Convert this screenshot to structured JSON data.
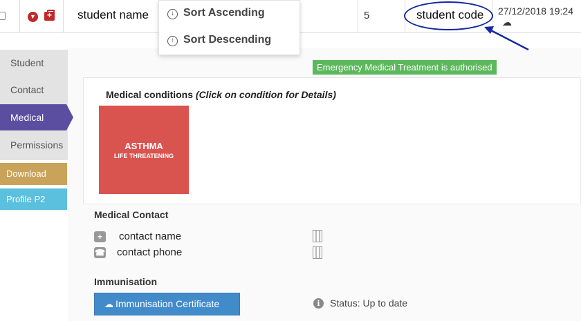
{
  "table_row": {
    "name": "student name",
    "count": "5",
    "code": "student code",
    "timestamp": "27/12/2018 19:24"
  },
  "sort_menu": {
    "ascending": "Sort Ascending",
    "descending": "Sort Descending"
  },
  "sidebar": {
    "tabs": [
      {
        "label": "Student"
      },
      {
        "label": "Contact"
      },
      {
        "label": "Medical"
      },
      {
        "label": "Permissions"
      }
    ],
    "active_tab": "Medical",
    "download_label": "Download",
    "profile_label": "Profile P2"
  },
  "emergency_banner": "Emergency Medical Treatment is authorised",
  "medical_conditions": {
    "title": "Medical conditions",
    "hint": "(Click on condition for Details)",
    "items": [
      {
        "name": "ASTHMA",
        "severity": "LIFE THREATENING"
      }
    ]
  },
  "medical_contact": {
    "title": "Medical Contact",
    "name": "contact name",
    "phone": "contact phone"
  },
  "immunisation": {
    "title": "Immunisation",
    "certificate_label": "Immunisation Certificate",
    "status": "Status: Up to date"
  },
  "colors": {
    "accent_active_tab": "#5b4ea0",
    "emergency": "#5cb85c",
    "condition_alert": "#d9534f",
    "primary_button": "#428bca",
    "annotation": "#1428a0"
  },
  "icons": {
    "checkbox": "checkbox-icon",
    "expand": "chevron-down-icon",
    "medical": "medkit-icon",
    "cloud_download": "cloud-download-icon",
    "sort_asc": "arrow-down-circle-icon",
    "sort_desc": "arrow-up-circle-icon",
    "hospital": "hospital-icon",
    "phone": "phone-icon",
    "building": "building-icon",
    "info": "info-circle-icon"
  }
}
